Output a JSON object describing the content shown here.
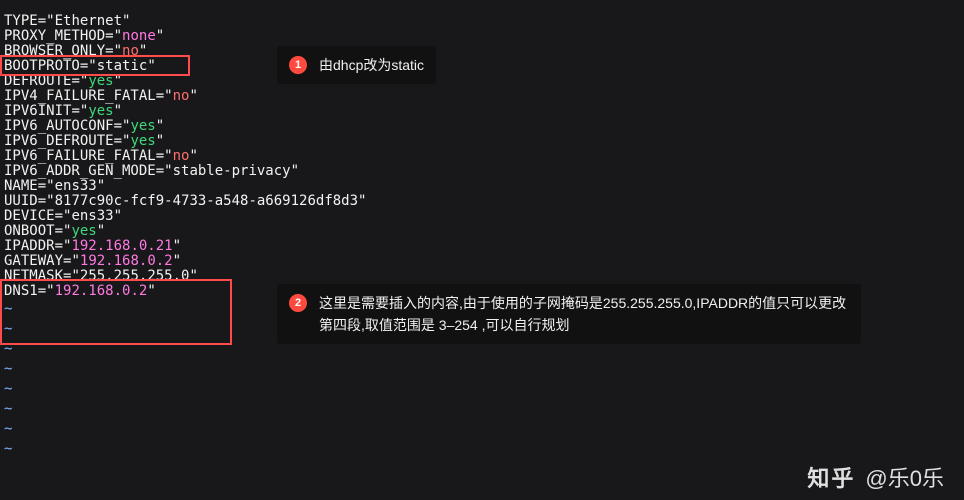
{
  "config_lines": [
    {
      "key": "TYPE",
      "value": "Ethernet",
      "cls": "kw"
    },
    {
      "key": "PROXY_METHOD",
      "value": "none",
      "cls": "str"
    },
    {
      "key": "BROWSER_ONLY",
      "value": "no",
      "cls": "no"
    },
    {
      "key": "BOOTPROTO",
      "value": "static",
      "cls": "kw"
    },
    {
      "key": "DEFROUTE",
      "value": "yes",
      "cls": "yes"
    },
    {
      "key": "IPV4_FAILURE_FATAL",
      "value": "no",
      "cls": "no"
    },
    {
      "key": "IPV6INIT",
      "value": "yes",
      "cls": "yes"
    },
    {
      "key": "IPV6_AUTOCONF",
      "value": "yes",
      "cls": "yes"
    },
    {
      "key": "IPV6_DEFROUTE",
      "value": "yes",
      "cls": "yes"
    },
    {
      "key": "IPV6_FAILURE_FATAL",
      "value": "no",
      "cls": "no"
    },
    {
      "key": "IPV6_ADDR_GEN_MODE",
      "value": "stable-privacy",
      "cls": "kw"
    },
    {
      "key": "NAME",
      "value": "ens33",
      "cls": "kw"
    },
    {
      "key": "UUID",
      "value": "8177c90c-fcf9-4733-a548-a669126df8d3",
      "cls": "kw"
    },
    {
      "key": "DEVICE",
      "value": "ens33",
      "cls": "kw"
    },
    {
      "key": "ONBOOT",
      "value": "yes",
      "cls": "yes"
    },
    {
      "key": "IPADDR",
      "value": "192.168.0.21",
      "cls": "str"
    },
    {
      "key": "GATEWAY",
      "value": "192.168.0.2",
      "cls": "str"
    },
    {
      "key": "NETMASK",
      "value": "255.255.255.0",
      "cls": "kw"
    },
    {
      "key": "DNS1",
      "value": "192.168.0.2",
      "cls": "str"
    }
  ],
  "tilde_line": "~",
  "tilde_count": 8,
  "annotations": {
    "a1": {
      "num": "1",
      "text": "由dhcp改为static"
    },
    "a2": {
      "num": "2",
      "text": "这里是需要插入的内容,由于使用的子网掩码是255.255.255.0,IPADDR的值只可以更改第四段,取值范围是 3–254 ,可以自行规划"
    }
  },
  "watermark": {
    "site": "知乎",
    "handle": "@乐0乐"
  }
}
